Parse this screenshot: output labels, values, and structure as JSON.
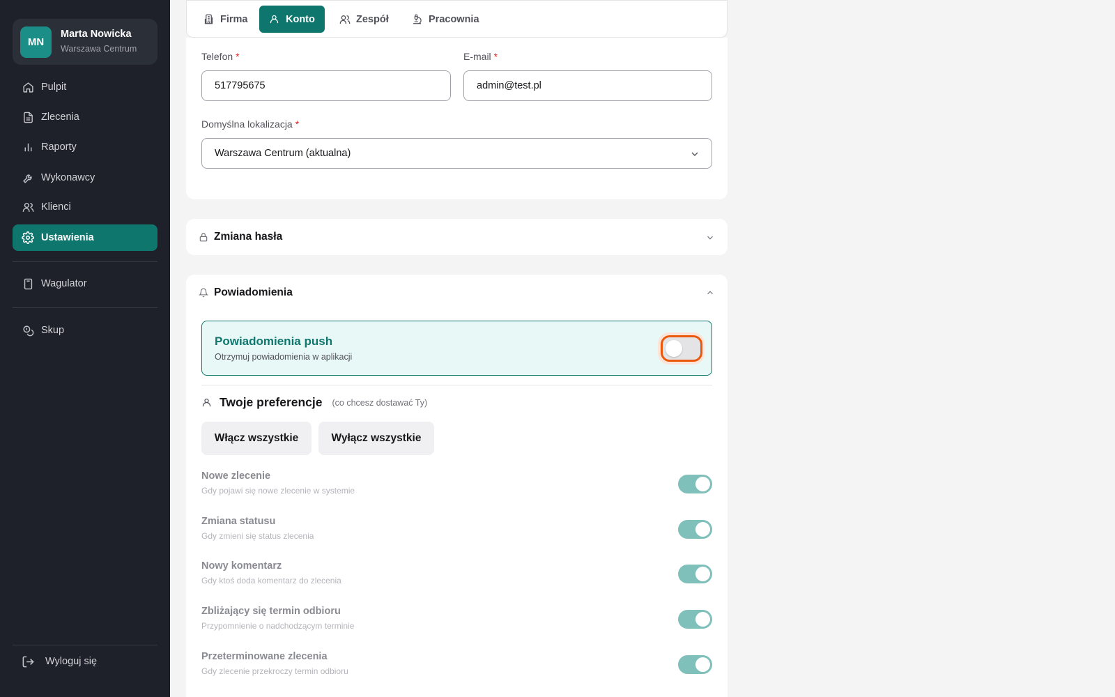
{
  "user": {
    "initials": "MN",
    "name": "Marta Nowicka",
    "location": "Warszawa Centrum"
  },
  "sidebar": {
    "items": [
      {
        "label": "Pulpit",
        "icon": "home-icon"
      },
      {
        "label": "Zlecenia",
        "icon": "document-icon"
      },
      {
        "label": "Raporty",
        "icon": "bar-chart-icon"
      },
      {
        "label": "Wykonawcy",
        "icon": "wrench-icon"
      },
      {
        "label": "Klienci",
        "icon": "users-icon"
      },
      {
        "label": "Ustawienia",
        "icon": "gear-icon",
        "active": true
      },
      {
        "label": "Wagulator",
        "icon": "calculator-icon"
      },
      {
        "label": "Skup",
        "icon": "coins-icon"
      }
    ],
    "logout": "Wyloguj się"
  },
  "tabs": [
    {
      "label": "Firma",
      "icon": "building-icon"
    },
    {
      "label": "Konto",
      "icon": "user-icon",
      "active": true
    },
    {
      "label": "Zespół",
      "icon": "users-icon"
    },
    {
      "label": "Pracownia",
      "icon": "microscope-icon"
    }
  ],
  "account": {
    "phone_label": "Telefon",
    "phone_value": "517795675",
    "email_label": "E-mail",
    "email_value": "admin@test.pl",
    "location_label": "Domyślna lokalizacja",
    "location_value": "Warszawa Centrum (aktualna)",
    "required_mark": "*"
  },
  "password_section": {
    "title": "Zmiana hasła"
  },
  "notifications": {
    "title": "Powiadomienia",
    "push_title": "Powiadomienia push",
    "push_subtitle": "Otrzymuj powiadomienia w aplikacji",
    "push_enabled": false,
    "prefs_title": "Twoje preferencje",
    "prefs_hint": "(co chcesz dostawać Ty)",
    "enable_all": "Włącz wszystkie",
    "disable_all": "Wyłącz wszystkie",
    "preferences": [
      {
        "title": "Nowe zlecenie",
        "desc": "Gdy pojawi się nowe zlecenie w systemie",
        "enabled": true
      },
      {
        "title": "Zmiana statusu",
        "desc": "Gdy zmieni się status zlecenia",
        "enabled": true
      },
      {
        "title": "Nowy komentarz",
        "desc": "Gdy ktoś doda komentarz do zlecenia",
        "enabled": true
      },
      {
        "title": "Zbliżający się termin odbioru",
        "desc": "Przypomnienie o nadchodzącym terminie",
        "enabled": true
      },
      {
        "title": "Przeterminowane zlecenia",
        "desc": "Gdy zlecenie przekroczy termin odbioru",
        "enabled": true
      }
    ]
  },
  "colors": {
    "accent": "#0f766e",
    "sidebar_bg": "#1e2129",
    "focus_ring": "#ea580c"
  }
}
